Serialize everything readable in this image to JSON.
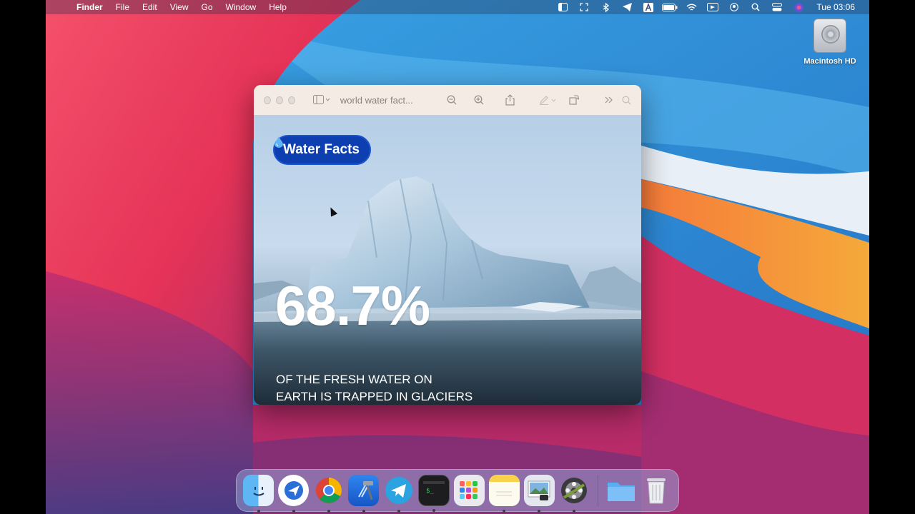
{
  "menubar": {
    "apple_glyph": "",
    "app_name": "Finder",
    "menus": [
      "File",
      "Edit",
      "View",
      "Go",
      "Window",
      "Help"
    ],
    "status_icons": [
      "sidebar-icon",
      "fullscreen-icon",
      "bluetooth-icon",
      "telegram-icon",
      "text-input-icon",
      "battery-icon",
      "wifi-icon",
      "screen-record-icon",
      "user-icon",
      "search-icon",
      "control-center-icon",
      "siri-icon"
    ],
    "clock": "Tue 03:06"
  },
  "desktop": {
    "drive_label": "Macintosh HD"
  },
  "preview": {
    "title": "world water fact...",
    "badge_label": "Water Facts",
    "headline": "68.7%",
    "caption_line1": "OF THE FRESH WATER ON",
    "caption_line2": "EARTH IS TRAPPED IN GLACIERS",
    "accent_color": "#0e3fb0"
  },
  "dock": {
    "apps": [
      "finder",
      "spark",
      "chrome",
      "xcode",
      "telegram",
      "terminal",
      "launchpad",
      "notes",
      "preview",
      "photo-slideshow",
      "downloads-folder",
      "trash"
    ]
  }
}
